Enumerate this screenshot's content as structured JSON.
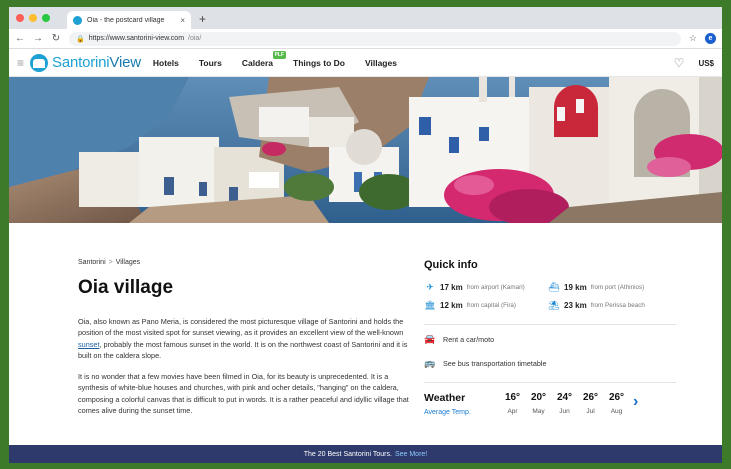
{
  "browser": {
    "tab_title": "Oia - the postcard village",
    "tab_close": "×",
    "new_tab": "+",
    "url_host": "https://www.santorini-view.com",
    "url_path": "/oia/",
    "colors": {
      "close": "#ff5f57",
      "min": "#febc2e",
      "max": "#28c840"
    }
  },
  "site": {
    "logo_a": "Santorini",
    "logo_b": "View",
    "menu": [
      {
        "label": "Hotels"
      },
      {
        "label": "Tours"
      },
      {
        "label": "Caldera",
        "badge": "PLF"
      },
      {
        "label": "Things to Do"
      },
      {
        "label": "Villages"
      }
    ],
    "currency": "US$"
  },
  "breadcrumb": {
    "parent": "Santorini",
    "sep": ">",
    "current": "Villages"
  },
  "page": {
    "title": "Oia village",
    "p1_a": "Oia, also known as Pano Meria, is considered the most picturesque village of Santorini and holds the position of the most visited spot for sunset viewing, as it provides an excellent view of the well-known ",
    "p1_link": "sunset",
    "p1_b": ", probably the most famous sunset in the world. It is on the northwest coast of Santorini and it is built on the caldera slope.",
    "p2": "It is no wonder that a few movies have been filmed in Oia, for its beauty is unprecedented. It is a synthesis of white-blue houses and churches, with pink and ocher details, \"hanging\" on the caldera, composing a colorful canvas that is difficult to put in words. It is a rather peaceful and idyllic village that comes alive during the sunset time."
  },
  "quick_info": {
    "title": "Quick info",
    "distances": [
      {
        "icon": "airplane-icon",
        "km": "17 km",
        "text": "from airport (Kamari)"
      },
      {
        "icon": "ship-icon",
        "km": "19 km",
        "text": "from port (Athinios)"
      },
      {
        "icon": "building-icon",
        "km": "12 km",
        "text": "from capital (Fira)"
      },
      {
        "icon": "umbrella-icon",
        "km": "23 km",
        "text": "from Perissa beach"
      }
    ],
    "rent": "Rent a car/moto",
    "bus": "See bus transportation timetable"
  },
  "weather": {
    "title": "Weather",
    "subtitle": "Average Temp.",
    "temps": [
      {
        "deg": "16°",
        "month": "Apr"
      },
      {
        "deg": "20°",
        "month": "May"
      },
      {
        "deg": "24°",
        "month": "Jun"
      },
      {
        "deg": "26°",
        "month": "Jul"
      },
      {
        "deg": "26°",
        "month": "Aug"
      }
    ]
  },
  "footer": {
    "text": "The 20 Best Santorini Tours.",
    "link": "See More!"
  }
}
